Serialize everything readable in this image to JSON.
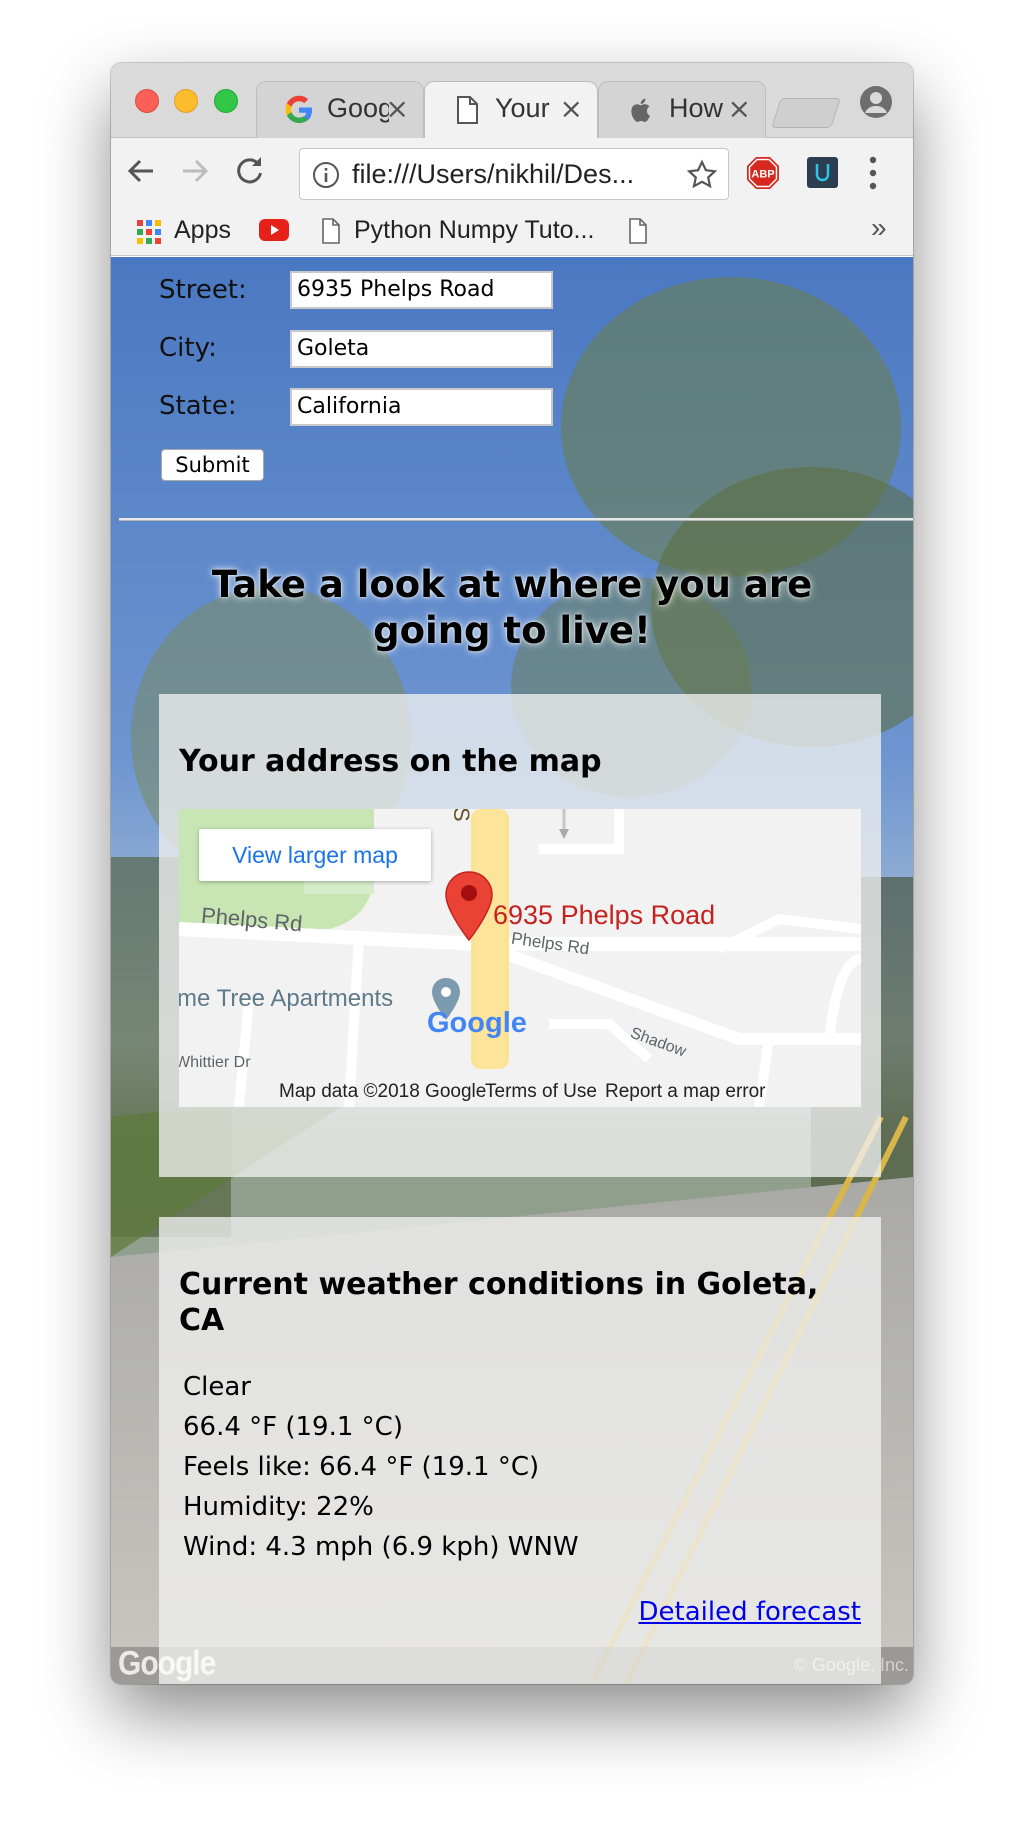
{
  "browser": {
    "tabs": [
      {
        "label": "Goog",
        "favicon": "google-icon"
      },
      {
        "label": "Your",
        "favicon": "page-icon"
      },
      {
        "label": "How",
        "favicon": "apple-icon"
      }
    ],
    "url": "file:///Users/nikhil/Des...",
    "bookmarks": {
      "apps": "Apps",
      "python": "Python Numpy Tuto..."
    },
    "overflow": "»"
  },
  "form": {
    "street_label": "Street:",
    "street_value": "6935 Phelps Road",
    "city_label": "City:",
    "city_value": "Goleta",
    "state_label": "State:",
    "state_value": "California",
    "submit_label": "Submit"
  },
  "headline": "Take a look at where you are going to live!",
  "map_card": {
    "title": "Your address on the map",
    "view_larger": "View larger map",
    "marker_label": "6935 Phelps Road",
    "street_labels": {
      "phelps_left": "Phelps Rd",
      "phelps_right": "Phelps Rd",
      "apartments": "me Tree Apartments",
      "whittier": "Whittier Dr",
      "shadow": "Shadow",
      "vertical": "S"
    },
    "google_logo": "Google",
    "footer": {
      "data": "Map data ©2018 Google",
      "terms": "Terms of Use",
      "report": "Report a map error"
    }
  },
  "weather_card": {
    "title": "Current weather conditions in Goleta, CA",
    "condition": "Clear",
    "temperature": "66.4 °F (19.1 °C)",
    "feels_like": "Feels like: 66.4 °F (19.1 °C)",
    "humidity": "Humidity: 22%",
    "wind": "Wind: 4.3 mph (6.9 kph) WNW",
    "forecast_link": "Detailed forecast"
  },
  "watermarks": {
    "google": "Google",
    "copyright": "© Google, Inc."
  },
  "colors": {
    "map_marker": "#ea4335",
    "marker_label": "#c5221f",
    "link": "#0000ee",
    "map_button_text": "#1a73e8"
  }
}
